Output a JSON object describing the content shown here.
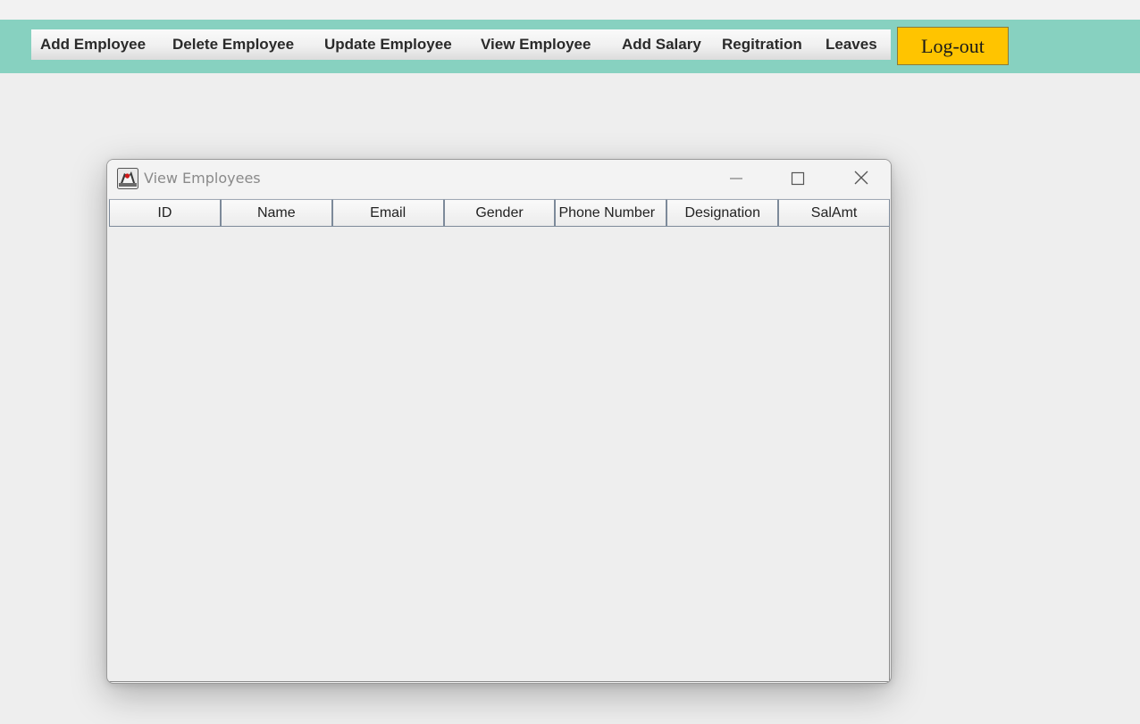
{
  "menu": {
    "items": [
      {
        "label": "Add Employee"
      },
      {
        "label": "Delete Employee"
      },
      {
        "label": "Update Employee"
      },
      {
        "label": "View Employee"
      },
      {
        "label": "Add Salary"
      },
      {
        "label": "Regitration"
      },
      {
        "label": "Leaves"
      }
    ],
    "band_color": "#87d1c0"
  },
  "logout": {
    "label": "Log-out",
    "color": "#ffc400"
  },
  "window": {
    "title": "View Employees",
    "icon": "java-duke-icon",
    "controls": [
      "minimize-icon",
      "maximize-icon",
      "close-icon"
    ]
  },
  "table": {
    "columns": [
      "ID",
      "Name",
      "Email",
      "Gender",
      "Phone Number",
      "Designation",
      "SalAmt"
    ],
    "rows": []
  }
}
